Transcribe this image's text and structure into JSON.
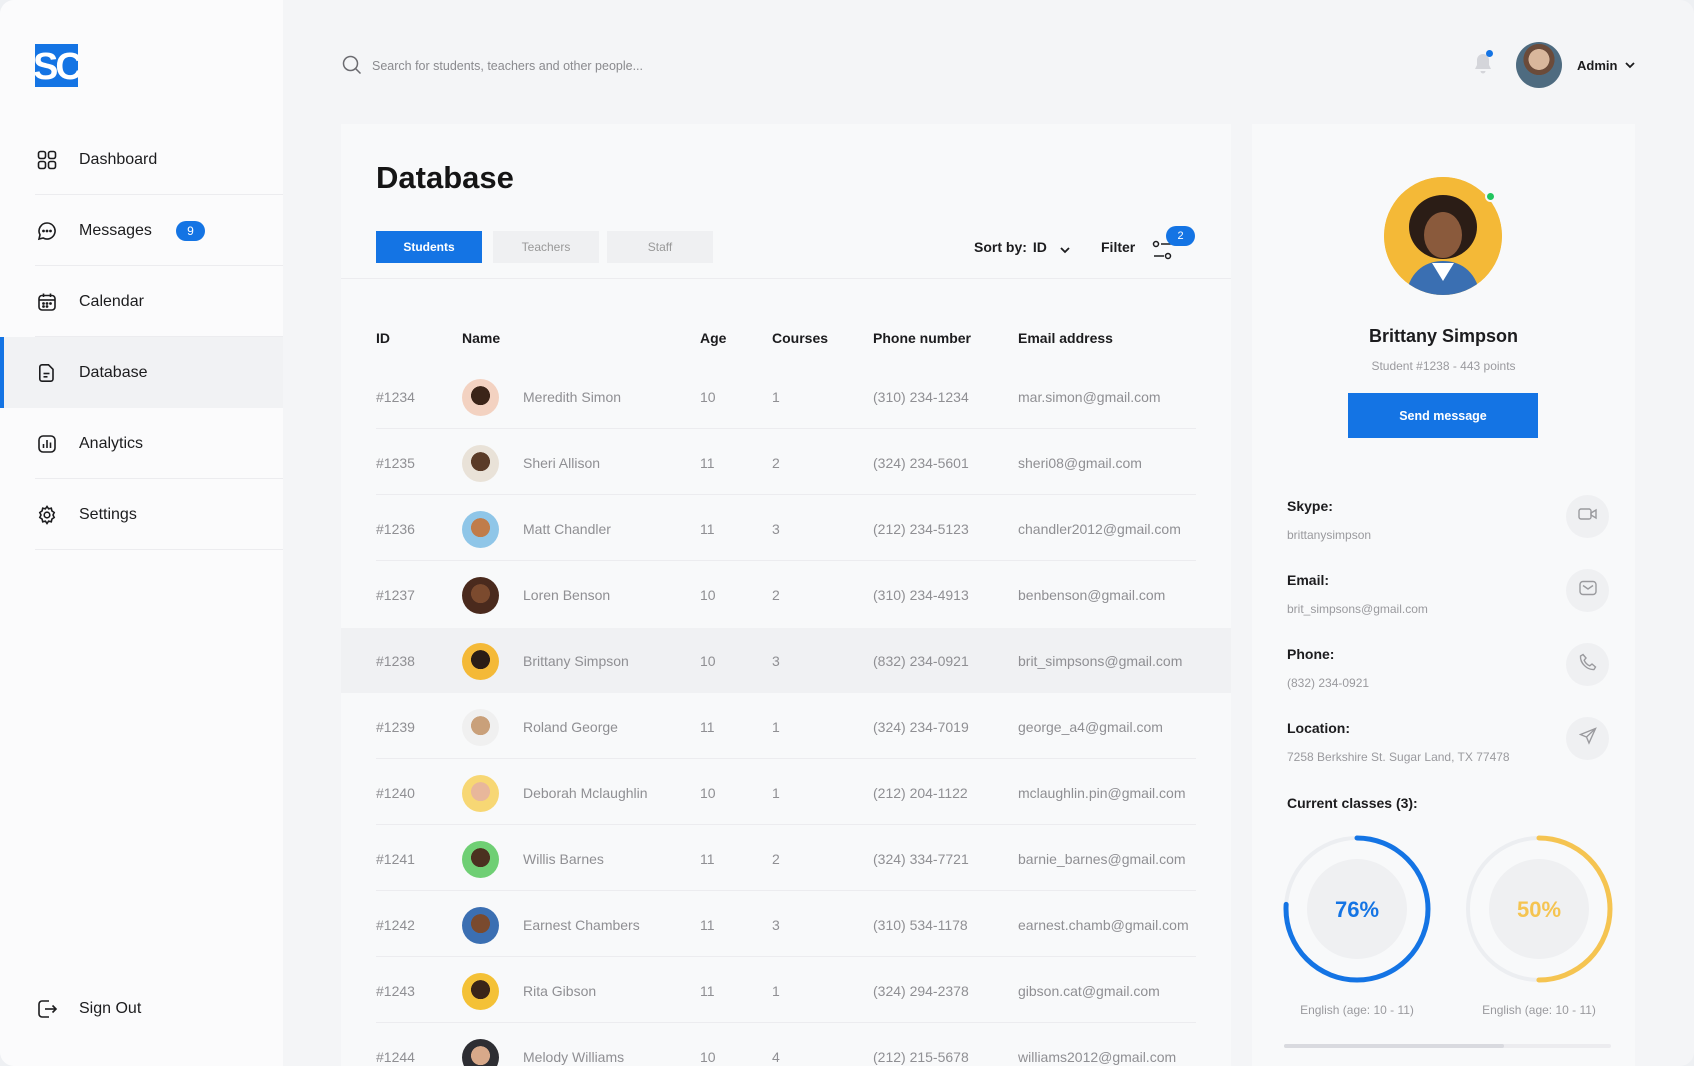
{
  "logo": {
    "text": "SC",
    "color": "#1474e4"
  },
  "sidebar": {
    "items": [
      {
        "label": "Dashboard",
        "icon": "grid-icon"
      },
      {
        "label": "Messages",
        "icon": "chat-icon",
        "badge": "9"
      },
      {
        "label": "Calendar",
        "icon": "calendar-icon"
      },
      {
        "label": "Database",
        "icon": "document-icon",
        "active": true
      },
      {
        "label": "Analytics",
        "icon": "chart-icon"
      },
      {
        "label": "Settings",
        "icon": "gear-icon"
      }
    ],
    "signout_label": "Sign Out"
  },
  "topbar": {
    "search_placeholder": "Search for students, teachers and other people...",
    "user_name": "Admin"
  },
  "main": {
    "title": "Database",
    "tabs": [
      "Students",
      "Teachers",
      "Staff"
    ],
    "active_tab": "Students",
    "sort_label": "Sort by:",
    "sort_value": "ID",
    "filter_label": "Filter",
    "filter_count": "2",
    "columns": [
      "ID",
      "Name",
      "Age",
      "Courses",
      "Phone number",
      "Email address"
    ],
    "rows": [
      {
        "id": "#1234",
        "name": "Meredith Simon",
        "age": "10",
        "courses": "1",
        "phone": "(310) 234-1234",
        "email": "mar.simon@gmail.com"
      },
      {
        "id": "#1235",
        "name": "Sheri Allison",
        "age": "11",
        "courses": "2",
        "phone": "(324) 234-5601",
        "email": "sheri08@gmail.com"
      },
      {
        "id": "#1236",
        "name": "Matt Chandler",
        "age": "11",
        "courses": "3",
        "phone": "(212) 234-5123",
        "email": "chandler2012@gmail.com"
      },
      {
        "id": "#1237",
        "name": "Loren Benson",
        "age": "10",
        "courses": "2",
        "phone": "(310) 234-4913",
        "email": "benbenson@gmail.com"
      },
      {
        "id": "#1238",
        "name": "Brittany Simpson",
        "age": "10",
        "courses": "3",
        "phone": "(832) 234-0921",
        "email": "brit_simpsons@gmail.com",
        "selected": true
      },
      {
        "id": "#1239",
        "name": "Roland George",
        "age": "11",
        "courses": "1",
        "phone": "(324) 234-7019",
        "email": "george_a4@gmail.com"
      },
      {
        "id": "#1240",
        "name": "Deborah Mclaughlin",
        "age": "10",
        "courses": "1",
        "phone": "(212) 204-1122",
        "email": "mclaughlin.pin@gmail.com"
      },
      {
        "id": "#1241",
        "name": "Willis Barnes",
        "age": "11",
        "courses": "2",
        "phone": "(324) 334-7721",
        "email": "barnie_barnes@gmail.com"
      },
      {
        "id": "#1242",
        "name": "Earnest Chambers",
        "age": "11",
        "courses": "3",
        "phone": "(310) 534-1178",
        "email": "earnest.chamb@gmail.com"
      },
      {
        "id": "#1243",
        "name": "Rita Gibson",
        "age": "11",
        "courses": "1",
        "phone": "(324) 294-2378",
        "email": "gibson.cat@gmail.com"
      },
      {
        "id": "#1244",
        "name": "Melody Williams",
        "age": "10",
        "courses": "4",
        "phone": "(212) 215-5678",
        "email": "williams2012@gmail.com"
      }
    ]
  },
  "profile": {
    "name": "Brittany Simpson",
    "subtitle": "Student #1238 - 443 points",
    "send_label": "Send message",
    "skype_label": "Skype:",
    "skype_value": "brittanysimpson",
    "email_label": "Email:",
    "email_value": "brit_simpsons@gmail.com",
    "phone_label": "Phone:",
    "phone_value": "(832) 234-0921",
    "location_label": "Location:",
    "location_value": "7258 Berkshire St. Sugar Land, TX 77478",
    "classes_label": "Current classes (3):",
    "classes": [
      {
        "percent": "76%",
        "progress": 0.76,
        "label": "English (age: 10 - 11)",
        "color": "#1474e4"
      },
      {
        "percent": "50%",
        "progress": 0.5,
        "label": "English (age: 10 - 11)",
        "color": "#f5c451"
      }
    ]
  },
  "colors": {
    "accent": "#1474e4",
    "online": "#22c55e",
    "ring2": "#f5c451"
  }
}
